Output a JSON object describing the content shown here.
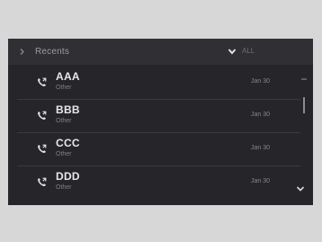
{
  "header": {
    "title": "Recents",
    "filter_label": "ALL"
  },
  "calls": [
    {
      "name": "AAA",
      "type": "Other",
      "date": "Jan 30"
    },
    {
      "name": "BBB",
      "type": "Other",
      "date": "Jan 30"
    },
    {
      "name": "CCC",
      "type": "Other",
      "date": "Jan 30"
    },
    {
      "name": "DDD",
      "type": "Other",
      "date": "Jan 30"
    }
  ],
  "icons": {
    "back": "chevron-right-icon",
    "filter": "chevron-down-icon",
    "call": "phone-icon",
    "scroll_down": "chevron-down-icon"
  },
  "colors": {
    "screen_bg": "#26262a",
    "header_bg": "#303034",
    "text_primary": "#e8e8ec",
    "text_secondary": "#7f7f85"
  }
}
